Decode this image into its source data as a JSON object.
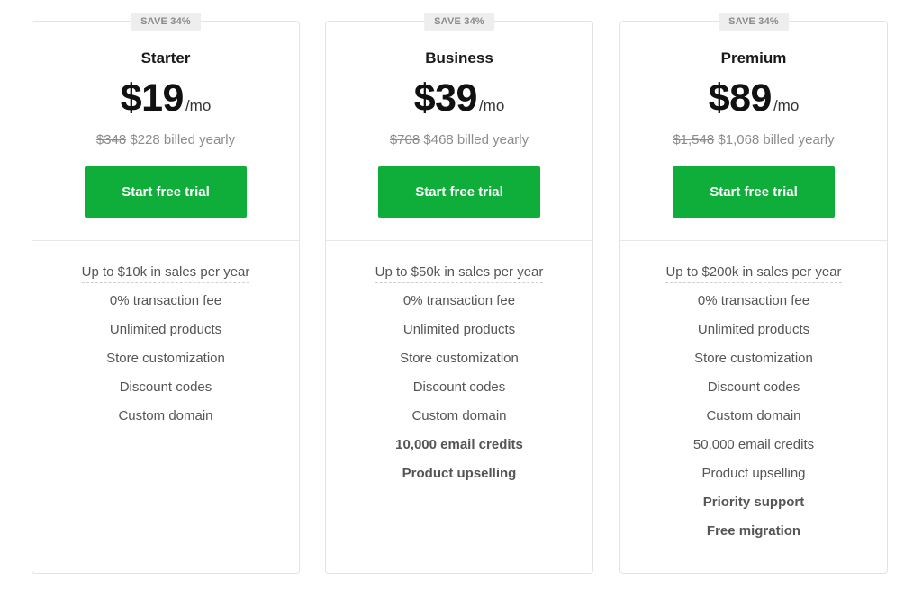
{
  "plans": [
    {
      "badge": "SAVE 34%",
      "name": "Starter",
      "price": "$19",
      "period": "/mo",
      "old_price": "$348",
      "billed": "$228 billed yearly",
      "cta": "Start free trial",
      "features": [
        {
          "text": "Up to $10k in sales per year",
          "style": "dotted"
        },
        {
          "text": "0% transaction fee",
          "style": "normal"
        },
        {
          "text": "Unlimited products",
          "style": "normal"
        },
        {
          "text": "Store customization",
          "style": "normal"
        },
        {
          "text": "Discount codes",
          "style": "normal"
        },
        {
          "text": "Custom domain",
          "style": "normal"
        }
      ]
    },
    {
      "badge": "SAVE 34%",
      "name": "Business",
      "price": "$39",
      "period": "/mo",
      "old_price": "$708",
      "billed": "$468 billed yearly",
      "cta": "Start free trial",
      "features": [
        {
          "text": "Up to $50k in sales per year",
          "style": "dotted"
        },
        {
          "text": "0% transaction fee",
          "style": "normal"
        },
        {
          "text": "Unlimited products",
          "style": "normal"
        },
        {
          "text": "Store customization",
          "style": "normal"
        },
        {
          "text": "Discount codes",
          "style": "normal"
        },
        {
          "text": "Custom domain",
          "style": "normal"
        },
        {
          "text": "10,000 email credits",
          "style": "bold"
        },
        {
          "text": "Product upselling",
          "style": "bold"
        }
      ]
    },
    {
      "badge": "SAVE 34%",
      "name": "Premium",
      "price": "$89",
      "period": "/mo",
      "old_price": "$1,548",
      "billed": "$1,068 billed yearly",
      "cta": "Start free trial",
      "features": [
        {
          "text": "Up to $200k in sales per year",
          "style": "dotted"
        },
        {
          "text": "0% transaction fee",
          "style": "normal"
        },
        {
          "text": "Unlimited products",
          "style": "normal"
        },
        {
          "text": "Store customization",
          "style": "normal"
        },
        {
          "text": "Discount codes",
          "style": "normal"
        },
        {
          "text": "Custom domain",
          "style": "normal"
        },
        {
          "text": "50,000 email credits",
          "style": "normal"
        },
        {
          "text": "Product upselling",
          "style": "normal"
        },
        {
          "text": "Priority support",
          "style": "bold"
        },
        {
          "text": "Free migration",
          "style": "bold"
        }
      ]
    }
  ],
  "colors": {
    "accent": "#0fae3b",
    "badge_bg": "#eeeeee",
    "muted_text": "#8c8c8c",
    "border": "#e3e3e3"
  }
}
